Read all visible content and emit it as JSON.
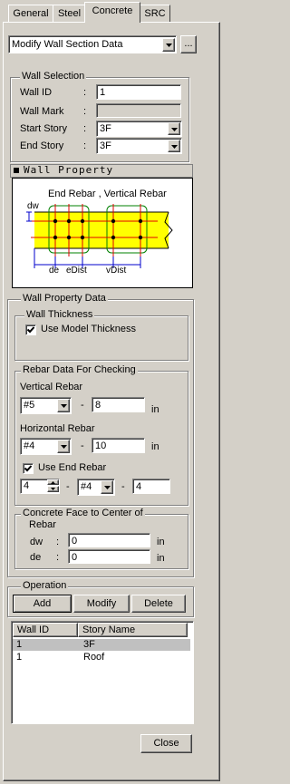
{
  "tabs": [
    "General",
    "Steel",
    "Concrete",
    "SRC"
  ],
  "mode_select": {
    "value": "Modify Wall Section Data",
    "more_button": "..."
  },
  "wall_selection": {
    "title": "Wall Selection",
    "wall_id_label": "Wall ID",
    "wall_id_value": "1",
    "wall_mark_label": "Wall Mark",
    "wall_mark_value": "",
    "start_story_label": "Start Story",
    "start_story_value": "3F",
    "end_story_label": "End Story",
    "end_story_value": "3F",
    "colon": ":"
  },
  "wall_property": {
    "title": "Wall Property",
    "diagram": {
      "top_label": "End Rebar , Vertical Rebar",
      "dw": "dw",
      "de": "de",
      "edist": "eDist",
      "vdist": "vDist"
    }
  },
  "wall_property_data": {
    "title": "Wall Property Data",
    "thickness": {
      "title": "Wall Thickness",
      "use_model_label": "Use Model Thickness",
      "use_model_checked": true
    },
    "rebar": {
      "title": "Rebar Data For Checking",
      "vertical_label": "Vertical Rebar",
      "vertical_size": "#5",
      "vertical_spacing": "8",
      "vertical_unit": "in",
      "horizontal_label": "Horizontal Rebar",
      "horizontal_size": "#4",
      "horizontal_spacing": "10",
      "horizontal_unit": "in",
      "use_end_label": "Use End Rebar",
      "use_end_checked": true,
      "end_count": "4",
      "end_size": "#4",
      "end_spacing": "4",
      "dash": "-"
    },
    "cover": {
      "title_line1": "Concrete Face to Center of",
      "title_line2": "Rebar",
      "dw_label": "dw",
      "dw_value": "0",
      "dw_unit": "in",
      "de_label": "de",
      "de_value": "0",
      "de_unit": "in",
      "colon": ":"
    }
  },
  "operation": {
    "title": "Operation",
    "add": "Add",
    "modify": "Modify",
    "delete": "Delete"
  },
  "table": {
    "headers": [
      "Wall ID",
      "Story Name"
    ],
    "rows": [
      {
        "id": "1",
        "story": "3F"
      },
      {
        "id": "1",
        "story": "Roof"
      }
    ]
  },
  "close_button": "Close",
  "colors": {
    "face": "#d4d0c8",
    "wall_fill": "#ffff00",
    "rebar_red": "#e00000",
    "dim_blue": "#0000cc",
    "cage_green": "#008000"
  }
}
